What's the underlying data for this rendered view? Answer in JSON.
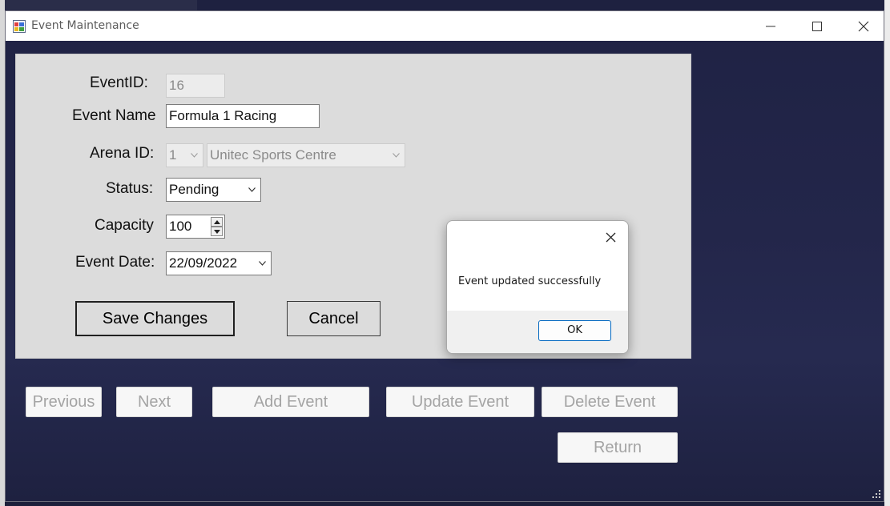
{
  "window": {
    "title": "Event Maintenance"
  },
  "form": {
    "event_id_label": "EventID:",
    "event_id_value": "16",
    "event_name_label": "Event Name",
    "event_name_value": "Formula 1 Racing",
    "arena_id_label": "Arena ID:",
    "arena_id_value": "1",
    "arena_name_value": "Unitec Sports Centre",
    "status_label": "Status:",
    "status_value": "Pending",
    "capacity_label": "Capacity",
    "capacity_value": "100",
    "event_date_label": "Event Date:",
    "event_date_value": "22/09/2022",
    "save_label": "Save Changes",
    "cancel_label": "Cancel"
  },
  "nav": {
    "previous_label": "Previous",
    "next_label": "Next",
    "add_label": "Add Event",
    "update_label": "Update Event",
    "delete_label": "Delete Event",
    "return_label": "Return"
  },
  "dialog": {
    "message": "Event updated successfully",
    "ok_label": "OK"
  },
  "icons": {
    "app": "app-icon",
    "minimize": "minimize-icon",
    "maximize": "maximize-icon",
    "close": "close-icon",
    "dropdown": "chevron-down-icon",
    "spin_up": "spin-up-icon",
    "spin_down": "spin-down-icon",
    "resize": "resize-grip-icon"
  },
  "colors": {
    "background": "#1c1f3a",
    "panel": "#dcdcdc",
    "dialog_ok_border": "#0067c0"
  }
}
